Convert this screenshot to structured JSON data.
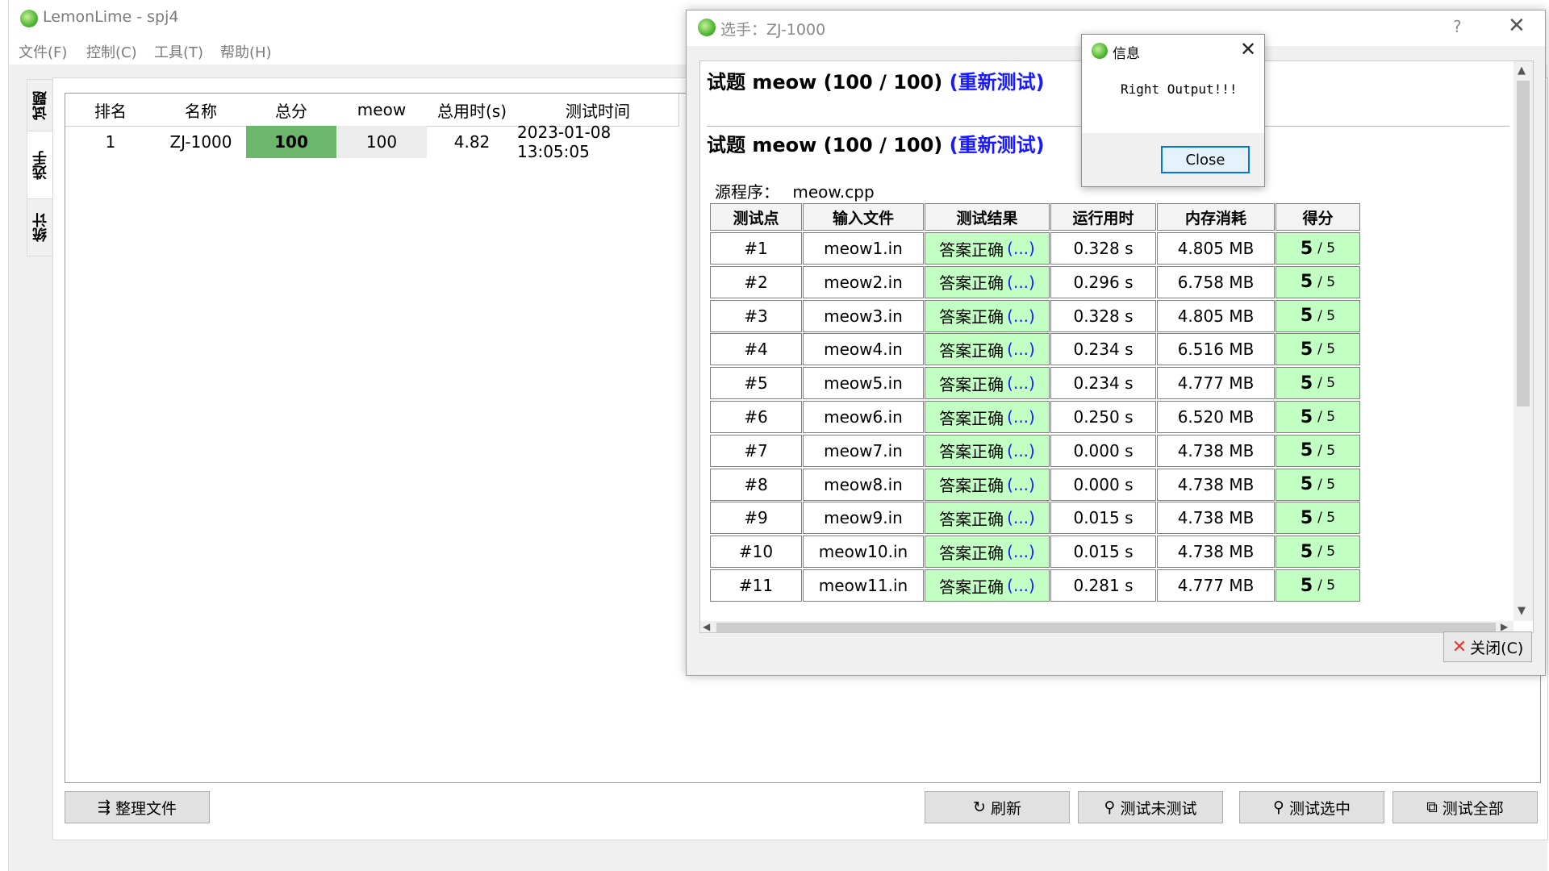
{
  "app": {
    "title": "LemonLime - spj4"
  },
  "menu": [
    "文件(F)",
    "控制(C)",
    "工具(T)",
    "帮助(H)"
  ],
  "side_tabs": [
    "试题",
    "选手",
    "统计"
  ],
  "ranking": {
    "headers": [
      "排名",
      "名称",
      "总分",
      "meow",
      "总用时(s)",
      "测试时间"
    ],
    "row": [
      "1",
      "ZJ-1000",
      "100",
      "100",
      "4.82",
      "2023-01-08 13:05:05"
    ],
    "total_color": "#6db76d",
    "meow_color": "#ececec"
  },
  "bottom_buttons": {
    "organize": "整理文件",
    "refresh": "刷新",
    "test_untested": "测试未测试",
    "test_selected": "测试选中",
    "test_all": "测试全部"
  },
  "player_dialog": {
    "title": "选手：ZJ-1000",
    "help": "?",
    "close_x": "✕",
    "task_heading": "试题 meow (100 / 100)",
    "retest": "(重新测试)",
    "source_label": "源程序：",
    "source_file": "meow.cpp",
    "headers": [
      "测试点",
      "输入文件",
      "测试结果",
      "运行用时",
      "内存消耗",
      "得分"
    ],
    "result_dots": "(...)",
    "rows": [
      {
        "id": "#1",
        "file": "meow1.in",
        "result": "答案正确",
        "time": "0.328 s",
        "mem": "4.805 MB",
        "score": "5",
        "max": "/ 5"
      },
      {
        "id": "#2",
        "file": "meow2.in",
        "result": "答案正确",
        "time": "0.296 s",
        "mem": "6.758 MB",
        "score": "5",
        "max": "/ 5"
      },
      {
        "id": "#3",
        "file": "meow3.in",
        "result": "答案正确",
        "time": "0.328 s",
        "mem": "4.805 MB",
        "score": "5",
        "max": "/ 5"
      },
      {
        "id": "#4",
        "file": "meow4.in",
        "result": "答案正确",
        "time": "0.234 s",
        "mem": "6.516 MB",
        "score": "5",
        "max": "/ 5"
      },
      {
        "id": "#5",
        "file": "meow5.in",
        "result": "答案正确",
        "time": "0.234 s",
        "mem": "4.777 MB",
        "score": "5",
        "max": "/ 5"
      },
      {
        "id": "#6",
        "file": "meow6.in",
        "result": "答案正确",
        "time": "0.250 s",
        "mem": "6.520 MB",
        "score": "5",
        "max": "/ 5"
      },
      {
        "id": "#7",
        "file": "meow7.in",
        "result": "答案正确",
        "time": "0.000 s",
        "mem": "4.738 MB",
        "score": "5",
        "max": "/ 5"
      },
      {
        "id": "#8",
        "file": "meow8.in",
        "result": "答案正确",
        "time": "0.000 s",
        "mem": "4.738 MB",
        "score": "5",
        "max": "/ 5"
      },
      {
        "id": "#9",
        "file": "meow9.in",
        "result": "答案正确",
        "time": "0.015 s",
        "mem": "4.738 MB",
        "score": "5",
        "max": "/ 5"
      },
      {
        "id": "#10",
        "file": "meow10.in",
        "result": "答案正确",
        "time": "0.015 s",
        "mem": "4.738 MB",
        "score": "5",
        "max": "/ 5"
      },
      {
        "id": "#11",
        "file": "meow11.in",
        "result": "答案正确",
        "time": "0.281 s",
        "mem": "4.777 MB",
        "score": "5",
        "max": "/ 5"
      }
    ],
    "close_button": "关闭(C)"
  },
  "info_dialog": {
    "title": "信息",
    "message": "Right Output!!!",
    "close_button": "Close"
  },
  "colors": {
    "pass_green": "#c2ffc2",
    "link_blue": "#1a1aff"
  }
}
